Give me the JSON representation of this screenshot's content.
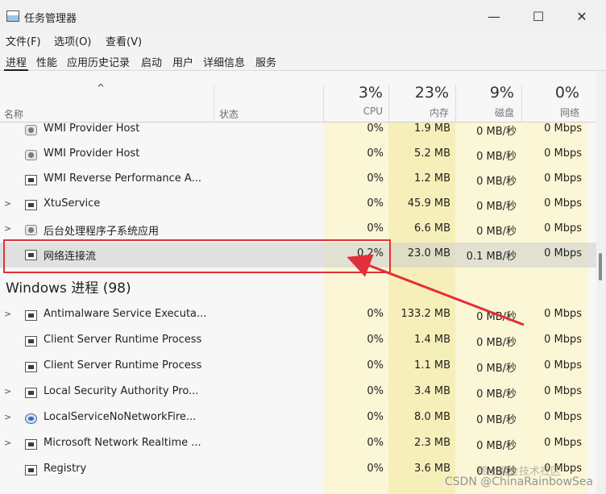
{
  "window": {
    "title": "任务管理器",
    "minimize": "—",
    "maximize": "☐",
    "close": "✕"
  },
  "menu": [
    "文件(F)",
    "选项(O)",
    "查看(V)"
  ],
  "tabs": [
    "进程",
    "性能",
    "应用历史记录",
    "启动",
    "用户",
    "详细信息",
    "服务"
  ],
  "active_tab": "进程",
  "header": {
    "sort_indicator": "^",
    "name": "名称",
    "status": "状态",
    "cpu_pct": "3%",
    "cpu": "CPU",
    "mem_pct": "23%",
    "mem": "内存",
    "disk_pct": "9%",
    "disk": "磁盘",
    "net_pct": "0%",
    "net": "网络"
  },
  "rows": [
    {
      "expander": "",
      "icon": "gear-icon",
      "name": "WMI Provider Host",
      "cpu": "0%",
      "mem": "1.9 MB",
      "disk": "0 MB/秒",
      "net": "0 Mbps"
    },
    {
      "expander": "",
      "icon": "gear-icon",
      "name": "WMI Provider Host",
      "cpu": "0%",
      "mem": "5.2 MB",
      "disk": "0 MB/秒",
      "net": "0 Mbps"
    },
    {
      "expander": "",
      "icon": "window-icon",
      "name": "WMI Reverse Performance A...",
      "cpu": "0%",
      "mem": "1.2 MB",
      "disk": "0 MB/秒",
      "net": "0 Mbps"
    },
    {
      "expander": ">",
      "icon": "window-icon",
      "name": "XtuService",
      "cpu": "0%",
      "mem": "45.9 MB",
      "disk": "0 MB/秒",
      "net": "0 Mbps"
    },
    {
      "expander": ">",
      "icon": "gear-icon",
      "name": "后台处理程序子系统应用",
      "cpu": "0%",
      "mem": "6.6 MB",
      "disk": "0 MB/秒",
      "net": "0 Mbps"
    },
    {
      "expander": "",
      "icon": "window-icon",
      "name": "网络连接流",
      "cpu": "0.2%",
      "mem": "23.0 MB",
      "disk": "0.1 MB/秒",
      "net": "0 Mbps",
      "selected": true
    }
  ],
  "group": "Windows 进程 (98)",
  "windows_rows": [
    {
      "expander": ">",
      "icon": "window-icon",
      "name": "Antimalware Service Executa...",
      "cpu": "0%",
      "mem": "133.2 MB",
      "disk": "0 MB/秒",
      "net": "0 Mbps"
    },
    {
      "expander": "",
      "icon": "window-icon",
      "name": "Client Server Runtime Process",
      "cpu": "0%",
      "mem": "1.4 MB",
      "disk": "0 MB/秒",
      "net": "0 Mbps"
    },
    {
      "expander": "",
      "icon": "window-icon",
      "name": "Client Server Runtime Process",
      "cpu": "0%",
      "mem": "1.1 MB",
      "disk": "0 MB/秒",
      "net": "0 Mbps"
    },
    {
      "expander": ">",
      "icon": "window-icon",
      "name": "Local Security Authority Pro...",
      "cpu": "0%",
      "mem": "3.4 MB",
      "disk": "0 MB/秒",
      "net": "0 Mbps"
    },
    {
      "expander": ">",
      "icon": "service-icon",
      "name": "LocalServiceNoNetworkFire...",
      "cpu": "0%",
      "mem": "8.0 MB",
      "disk": "0 MB/秒",
      "net": "0 Mbps"
    },
    {
      "expander": ">",
      "icon": "window-icon",
      "name": "Microsoft Network Realtime ...",
      "cpu": "0%",
      "mem": "2.3 MB",
      "disk": "0 MB/秒",
      "net": "0 Mbps"
    },
    {
      "expander": "",
      "icon": "window-icon",
      "name": "Registry",
      "cpu": "0%",
      "mem": "3.6 MB",
      "disk": "0 MB/秒",
      "net": "0 Mbps"
    }
  ],
  "colors": {
    "cpu_col": "#fbf6d6",
    "mem_col": "#f7efb9",
    "disk_col": "#fbf6d6",
    "net_col": "#fbf6d6",
    "highlight": "#e2303a"
  },
  "watermark": "CSDN @ChinaRainbowSea",
  "watermark_overlay": "稀土掘金技术社区"
}
